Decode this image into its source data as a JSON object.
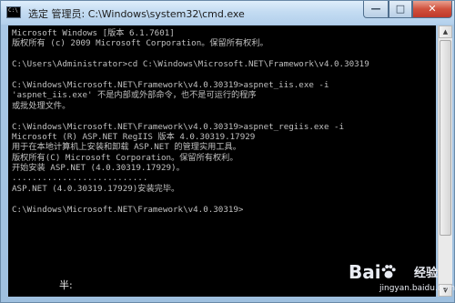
{
  "window": {
    "title": "选定 管理员: C:\\Windows\\system32\\cmd.exe",
    "icon": "console-icon",
    "controls": [
      "minimize",
      "maximize",
      "close"
    ]
  },
  "console": {
    "lines": [
      "Microsoft Windows [版本 6.1.7601]",
      "版权所有 (c) 2009 Microsoft Corporation。保留所有权利。",
      "",
      "C:\\Users\\Administrator>cd C:\\Windows\\Microsoft.NET\\Framework\\v4.0.30319",
      "",
      "C:\\Windows\\Microsoft.NET\\Framework\\v4.0.30319>aspnet_iis.exe -i",
      "'aspnet_iis.exe' 不是内部或外部命令，也不是可运行的程序",
      "或批处理文件。",
      "",
      "C:\\Windows\\Microsoft.NET\\Framework\\v4.0.30319>aspnet_regiis.exe -i",
      "Microsoft (R) ASP.NET RegIIS 版本 4.0.30319.17929",
      "用于在本地计算机上安装和卸载 ASP.NET 的管理实用工具。",
      "版权所有(C) Microsoft Corporation。保留所有权利。",
      "开始安装 ASP.NET (4.0.30319.17929)。",
      "...........................",
      "ASP.NET (4.0.30319.17929)安装完毕。",
      "",
      "C:\\Windows\\Microsoft.NET\\Framework\\v4.0.30319>"
    ]
  },
  "ime": {
    "text": "半:"
  },
  "watermark": {
    "logo": "Bai",
    "logo_suffix": "经验",
    "url": "jingyan.baidu.com"
  },
  "colors": {
    "console_bg": "#000000",
    "console_text": "#c0c0c0",
    "close_button": "#c0392b"
  }
}
